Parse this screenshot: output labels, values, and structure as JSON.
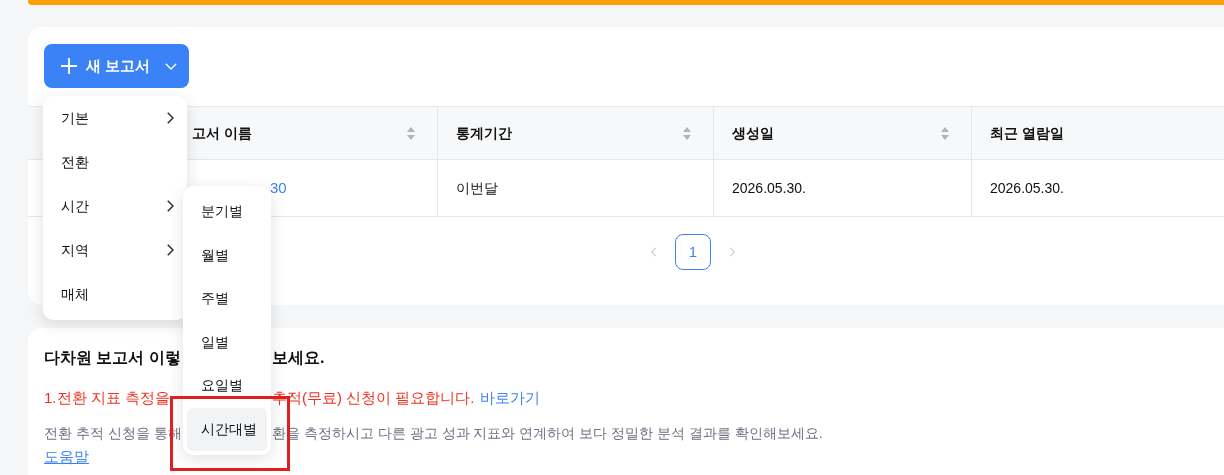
{
  "toolbar": {
    "new_report_button": {
      "label": "새 보고서"
    }
  },
  "table": {
    "columns": [
      {
        "label": "고서 이름",
        "sortable": true
      },
      {
        "label": "통계기간",
        "sortable": true
      },
      {
        "label": "생성일",
        "sortable": true
      },
      {
        "label": "최근 열람일",
        "sortable": false
      }
    ],
    "rows": [
      {
        "cells": [
          "30",
          "이번달",
          "2026.05.30.",
          "2026.05.30."
        ]
      }
    ]
  },
  "pagination": {
    "pages": [
      {
        "label": "1",
        "selected": true
      }
    ]
  },
  "info": {
    "heading_parts": [
      "다차원 보고서 이렇",
      "보세요."
    ],
    "notice_parts": [
      "1.전환 지표 측정을",
      "추적(무료) 신청이 필요합니다."
    ],
    "notice_link": "바로가기",
    "description_parts": [
      "전환 추적 신청을 통해",
      "환을 측정하시고 다른 광고 성과 지표와 연계하여 보다 정밀한 분석 결과를 확인해보세요."
    ],
    "help_link": "도움말"
  },
  "menu": {
    "items": [
      {
        "label": "기본",
        "kind": "submenu"
      },
      {
        "label": "전환",
        "kind": "action"
      },
      {
        "label": "시간",
        "kind": "submenu"
      },
      {
        "label": "지역",
        "kind": "submenu"
      },
      {
        "label": "매체",
        "kind": "action"
      }
    ]
  },
  "submenu": {
    "items": [
      {
        "label": "분기별",
        "selected": false
      },
      {
        "label": "월별",
        "selected": false
      },
      {
        "label": "주별",
        "selected": false
      },
      {
        "label": "일별",
        "selected": false
      },
      {
        "label": "요일별",
        "selected": false
      },
      {
        "label": "시간대별",
        "selected": true
      }
    ]
  }
}
